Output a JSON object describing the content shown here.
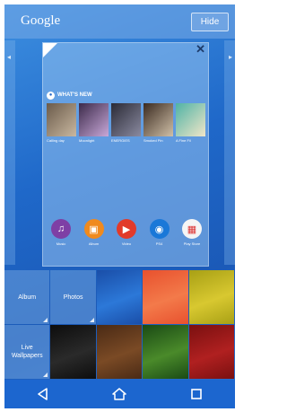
{
  "topbar": {
    "title": "Google",
    "hide_label": "Hide"
  },
  "page_preview": {
    "whats_new": {
      "title": "WHAT'S NEW",
      "items": [
        {
          "label": "Calling day",
          "colors": [
            "#6a5a4a",
            "#c9b8a0"
          ]
        },
        {
          "label": "Moonlight",
          "colors": [
            "#3b2a4a",
            "#c9a8d8"
          ]
        },
        {
          "label": "ENERGIES",
          "colors": [
            "#2a2a35",
            "#8a8aa0"
          ]
        },
        {
          "label": "Smoked Pin",
          "colors": [
            "#3a2a20",
            "#d0c0a8"
          ]
        },
        {
          "label": "A Fine Fil",
          "colors": [
            "#4fb3a5",
            "#f1e6c8"
          ]
        }
      ]
    },
    "dock": [
      {
        "label": "Music",
        "icon": "music-note-icon",
        "glyph": "♫",
        "color": "#7e3fa5"
      },
      {
        "label": "Album",
        "icon": "album-icon",
        "glyph": "▣",
        "color": "#f08a1e"
      },
      {
        "label": "Video",
        "icon": "video-icon",
        "glyph": "▶",
        "color": "#e23a2a"
      },
      {
        "label": "PS4",
        "icon": "playstation-icon",
        "glyph": "◉",
        "color": "#1a78d8"
      },
      {
        "label": "Play Store",
        "icon": "play-store-icon",
        "glyph": "▦",
        "color": "#f5f5f5"
      }
    ]
  },
  "picker": {
    "album_label": "Album",
    "photos_label": "Photos",
    "live_label": "Live Wallpapers",
    "row1_tiles": [
      {
        "colors": [
          "#1a4ea8",
          "#2c78d8"
        ]
      },
      {
        "colors": [
          "#e8512e",
          "#f37a4a"
        ]
      },
      {
        "colors": [
          "#a8a015",
          "#d8c830"
        ]
      }
    ],
    "row2_tiles": [
      {
        "colors": [
          "#0d0d0d",
          "#2a2a2a"
        ]
      },
      {
        "colors": [
          "#4a2a15",
          "#7a4a25"
        ]
      },
      {
        "colors": [
          "#1a4a15",
          "#4a8a2a"
        ]
      },
      {
        "colors": [
          "#7a1010",
          "#b02020"
        ]
      }
    ]
  },
  "navbar": {
    "back": "back-icon",
    "home": "home-icon",
    "recents": "recents-icon"
  }
}
